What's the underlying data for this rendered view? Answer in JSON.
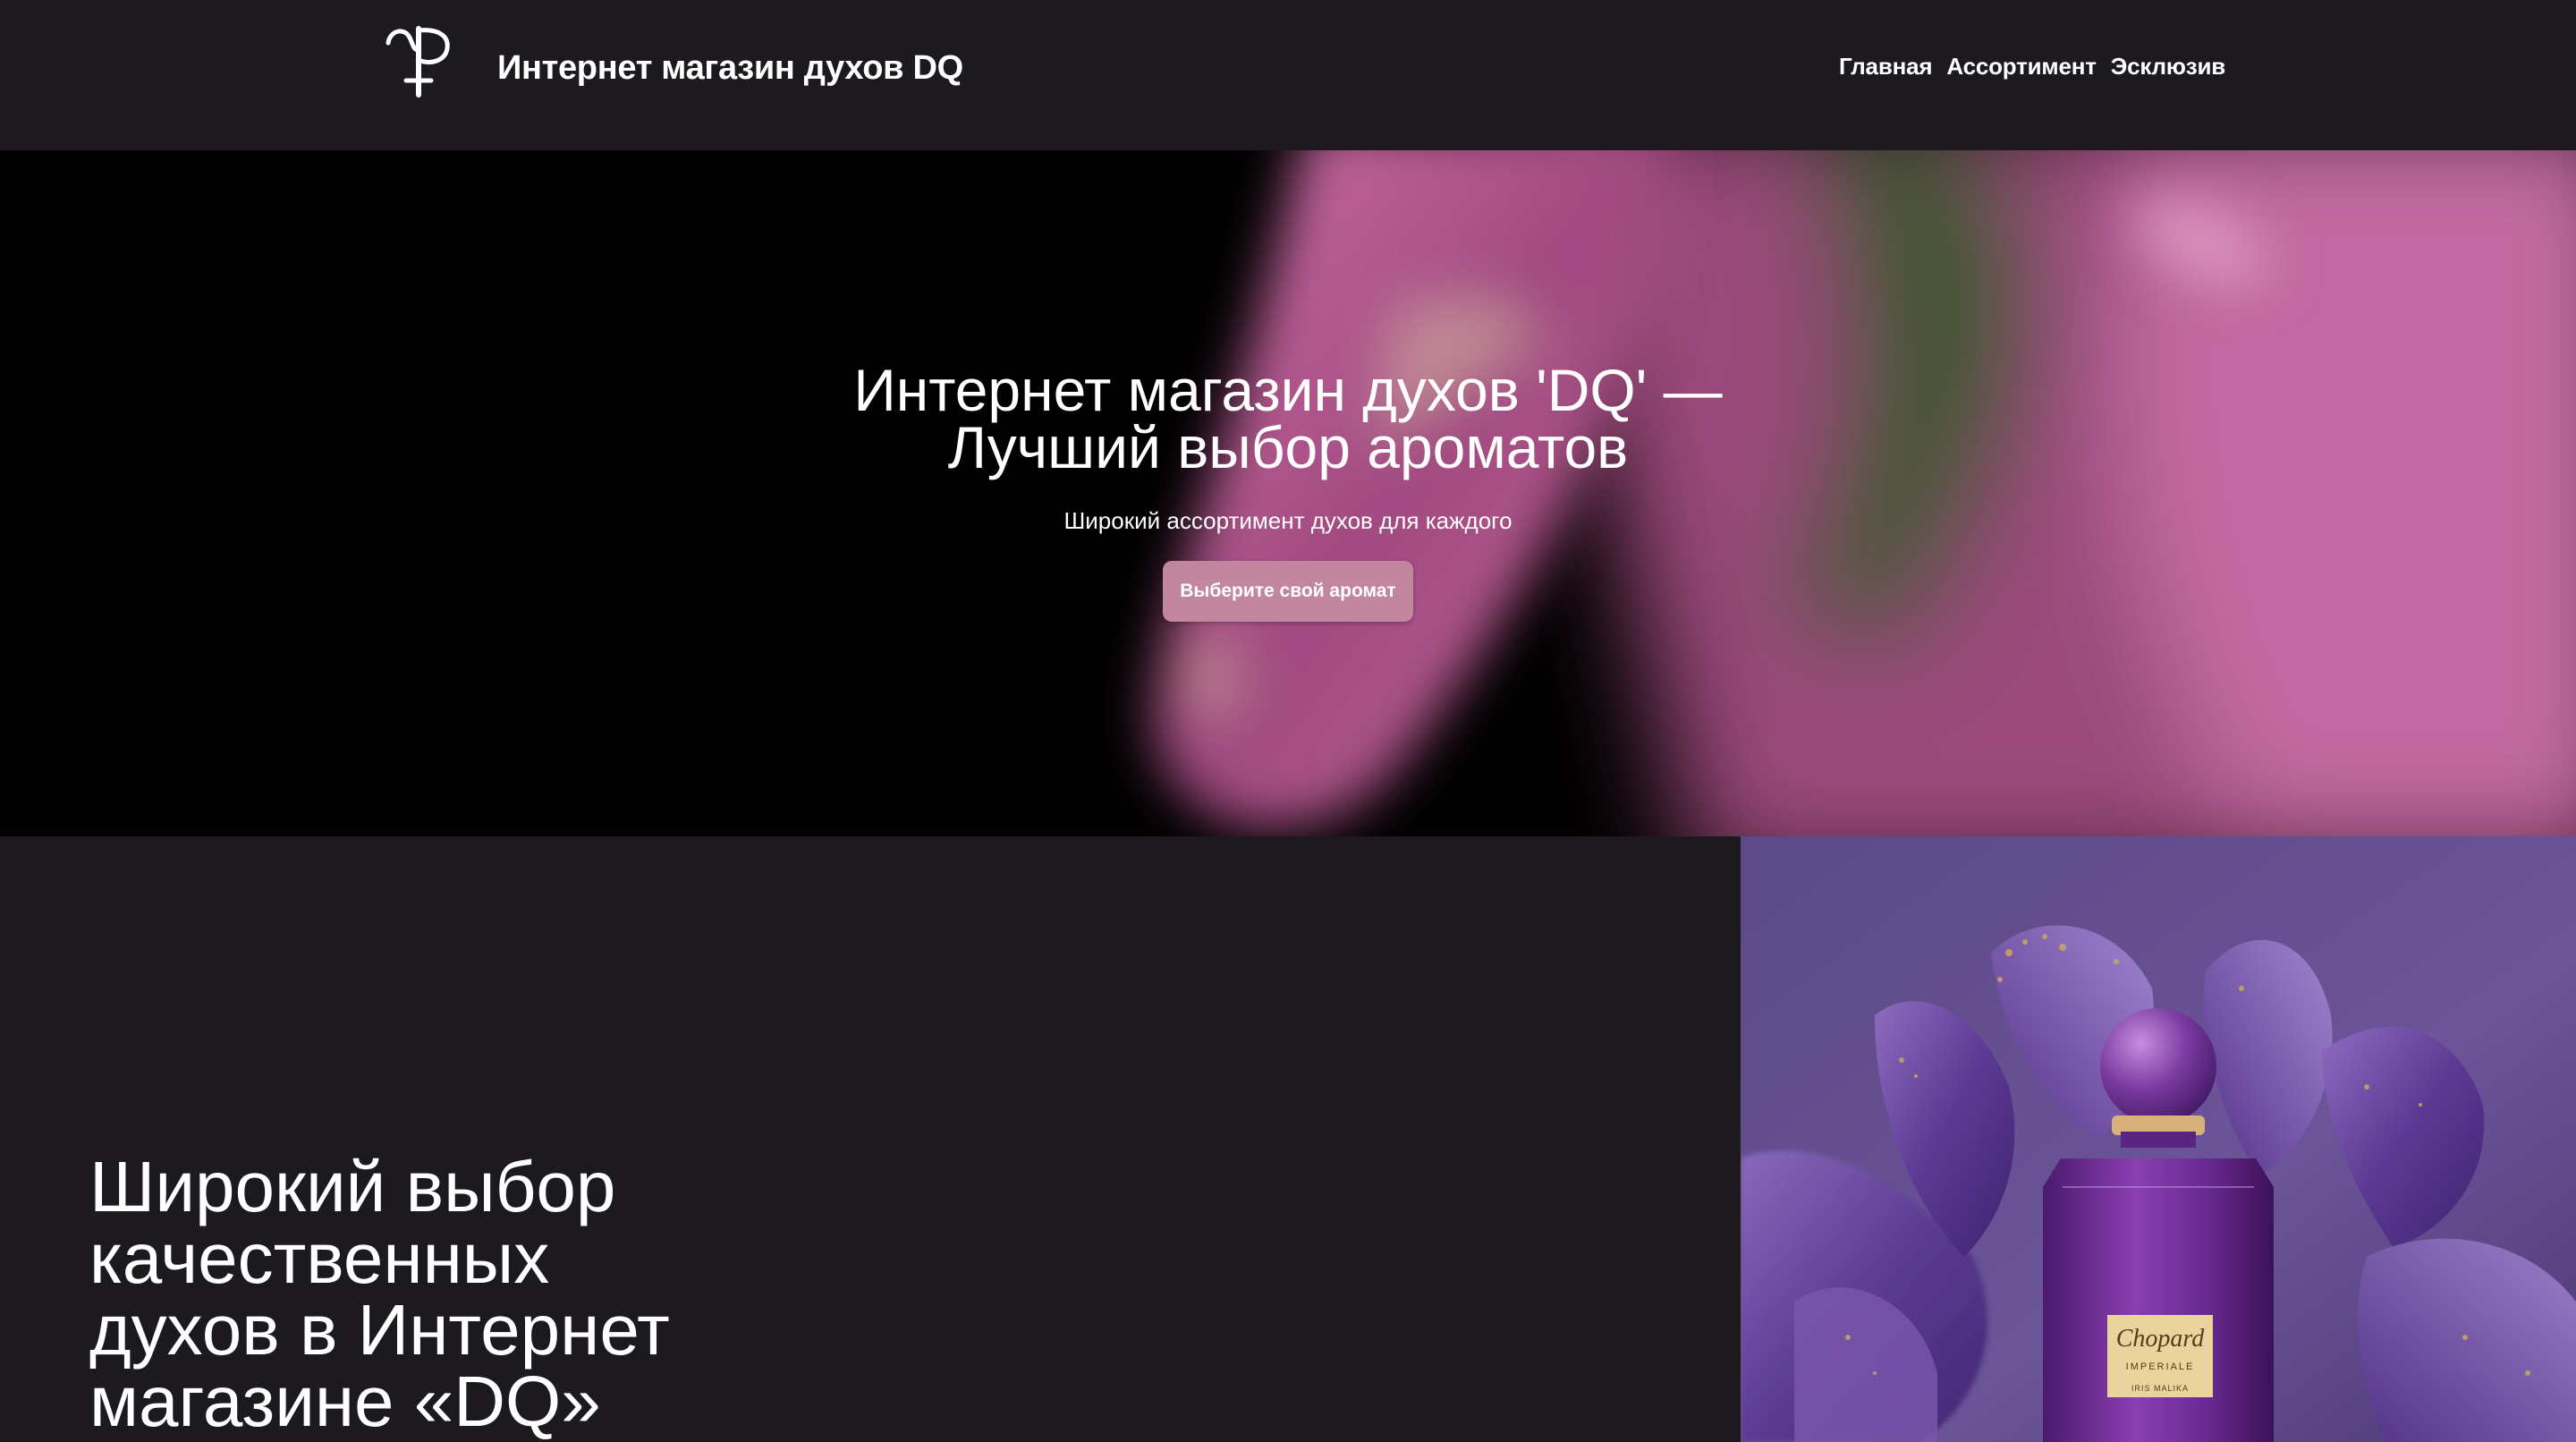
{
  "header": {
    "site_title": "Интернет магазин духов DQ",
    "nav": [
      "Главная",
      "Ассортимент",
      "Эсклюзив"
    ]
  },
  "hero": {
    "title_line1": "Интернет магазин духов 'DQ' —",
    "title_line2": "Лучший выбор ароматов",
    "subtitle": "Широкий ассортимент духов для каждого",
    "cta": "Выберите свой аромат"
  },
  "feature": {
    "heading_lines": [
      "Широкий выбор",
      "качественных",
      "духов в Интернет",
      "магазине «DQ»"
    ],
    "image": {
      "label_brand": "Chopard",
      "label_line": "IMPERIALE",
      "label_name": "IRIS MALIKA"
    }
  },
  "colors": {
    "background": "#1c1a1f",
    "hero_base": "#000000",
    "button": "#c2869f",
    "text": "#ffffff"
  },
  "icons": [
    "logo-monogram-icon"
  ]
}
